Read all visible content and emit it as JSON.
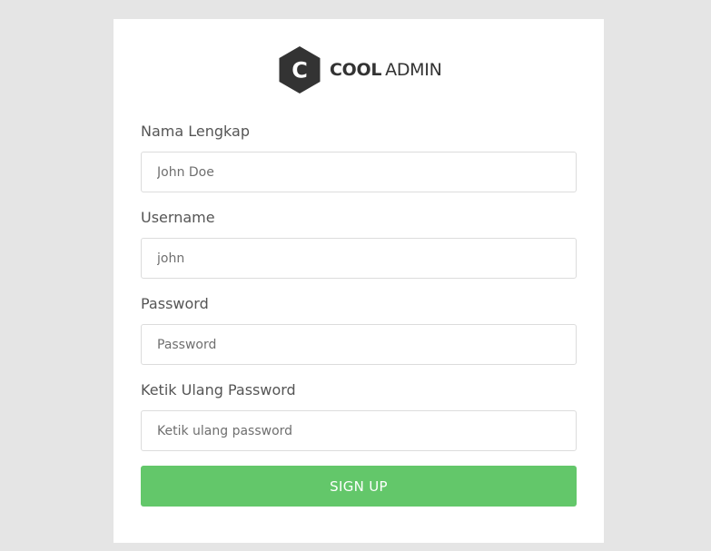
{
  "brand": {
    "logo_letter": "C",
    "name_bold": "COOL",
    "name_light": "ADMIN",
    "icon": "hexagon-c-logo-icon"
  },
  "form": {
    "fields": [
      {
        "label": "Nama Lengkap",
        "placeholder": "John Doe",
        "type": "text"
      },
      {
        "label": "Username",
        "placeholder": "john",
        "type": "text"
      },
      {
        "label": "Password",
        "placeholder": "Password",
        "type": "password"
      },
      {
        "label": "Ketik Ulang Password",
        "placeholder": "Ketik ulang password",
        "type": "password"
      }
    ],
    "submit_label": "SIGN UP"
  },
  "colors": {
    "background": "#e5e5e5",
    "card": "#ffffff",
    "logo_hex": "#333333",
    "button": "#63c76a",
    "label_text": "#555555",
    "input_border": "#dcdcdc"
  }
}
